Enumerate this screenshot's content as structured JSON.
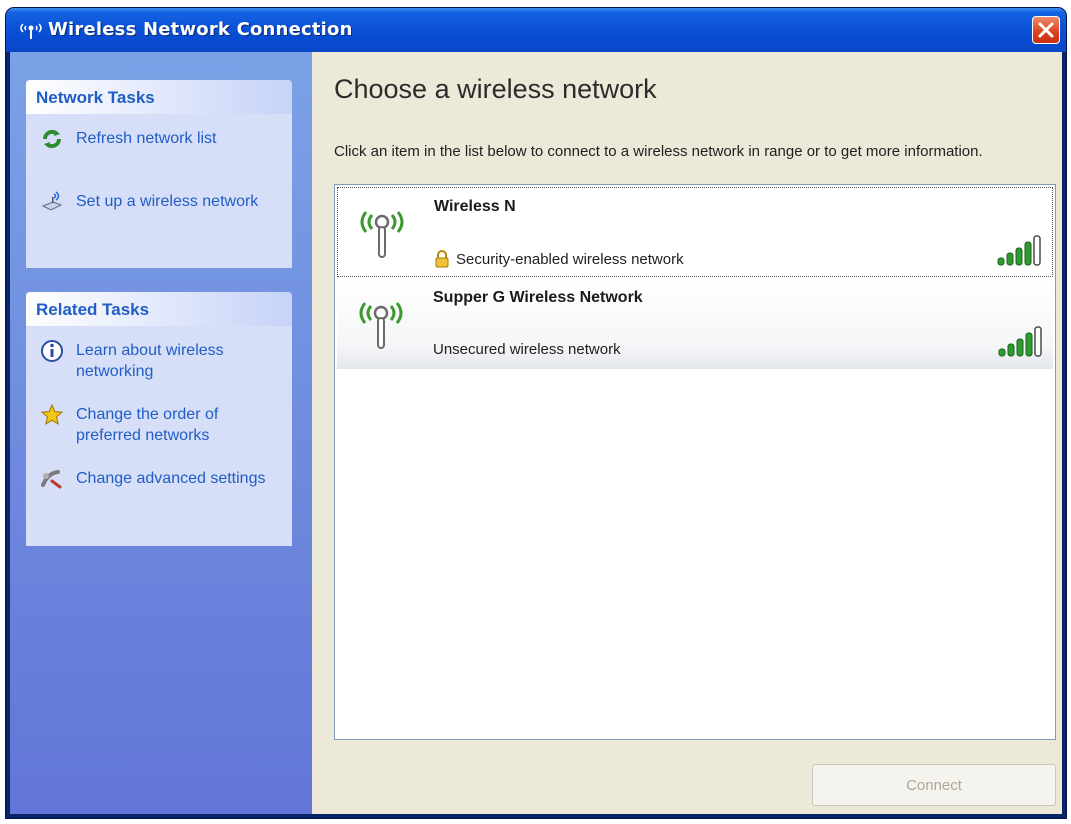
{
  "window": {
    "title": "Wireless Network Connection",
    "close_label": "Close"
  },
  "sidebar": {
    "network_tasks": {
      "header": "Network Tasks",
      "items": [
        {
          "label": "Refresh network list",
          "icon": "refresh-icon"
        },
        {
          "label": "Set up a wireless network",
          "icon": "setup-wireless-icon"
        }
      ]
    },
    "related_tasks": {
      "header": "Related Tasks",
      "items": [
        {
          "label": "Learn about wireless networking",
          "icon": "info-icon"
        },
        {
          "label": "Change the order of preferred networks",
          "icon": "star-icon"
        },
        {
          "label": "Change advanced settings",
          "icon": "settings-icon"
        }
      ]
    }
  },
  "main": {
    "title": "Choose a wireless network",
    "description": "Click an item in the list below to connect to a wireless network in range or to get more information.",
    "networks": [
      {
        "name": "Wireless N",
        "security": "Security-enabled wireless network",
        "secured": true,
        "signal_bars": 5,
        "selected": true
      },
      {
        "name": "Supper G Wireless Network",
        "security": "Unsecured wireless network",
        "secured": false,
        "signal_bars": 5,
        "selected": false
      }
    ],
    "connect_label": "Connect",
    "connect_enabled": false
  },
  "colors": {
    "titlebar": "#0a51d6",
    "sidebar_top": "#7ba2e7",
    "sidebar_bottom": "#6375d6",
    "link": "#215dc6",
    "signal": "#2e9b2e"
  }
}
